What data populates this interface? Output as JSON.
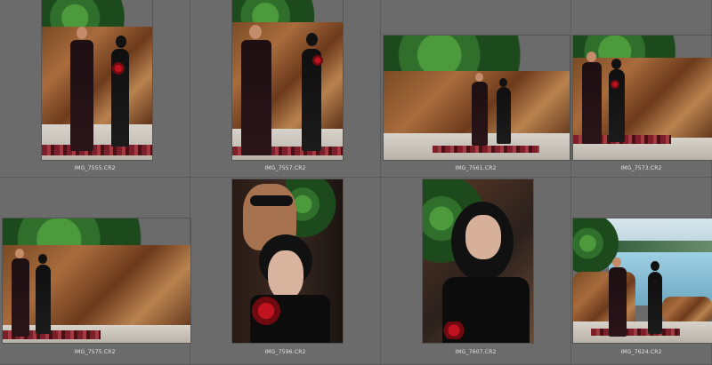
{
  "grid": {
    "rows": 2,
    "cols": 4
  },
  "photos": [
    {
      "filename": "IMG_7555.CR2"
    },
    {
      "filename": "IMG_7557.CR2"
    },
    {
      "filename": "IMG_7561.CR2"
    },
    {
      "filename": "IMG_7573.CR2"
    },
    {
      "filename": "IMG_7575.CR2"
    },
    {
      "filename": "IMG_7596.CR2"
    },
    {
      "filename": "IMG_7607.CR2"
    },
    {
      "filename": "IMG_7624.CR2"
    }
  ],
  "colors": {
    "background": "#6b6b6b",
    "divider": "#5a5a5a",
    "filename_text": "#e6e6e6"
  }
}
